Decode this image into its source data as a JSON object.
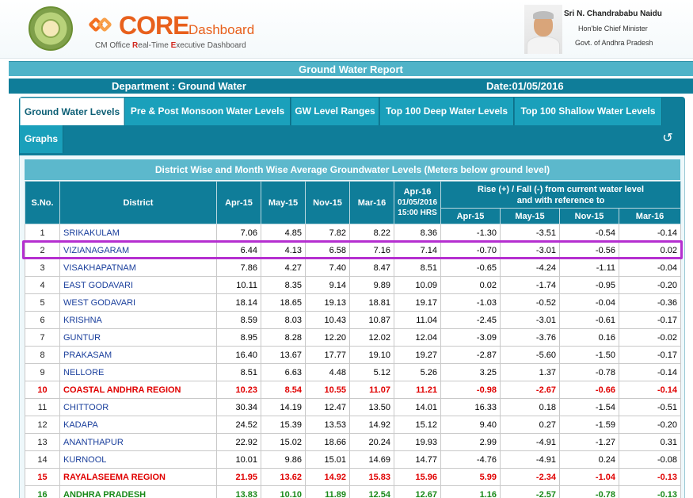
{
  "header": {
    "logo_word": "CORE",
    "logo_sub": "Dashboard",
    "tagline_parts": [
      "CM Office ",
      "R",
      "eal-Time ",
      "E",
      "xecutive Dashboard"
    ],
    "cm_name": "Sri N. Chandrababu Naidu",
    "cm_title": "Hon'ble Chief Minister",
    "cm_govt": "Govt. of Andhra Pradesh"
  },
  "report": {
    "title": "Ground Water Report",
    "department": "Department : Ground Water",
    "date": "Date:01/05/2016"
  },
  "tabs": [
    {
      "label": "Ground Water Levels",
      "active": true
    },
    {
      "label": "Pre & Post Monsoon Water Levels",
      "active": false
    },
    {
      "label": "GW Level Ranges",
      "active": false
    },
    {
      "label": "Top 100 Deep Water Levels",
      "active": false
    },
    {
      "label": "Top 100 Shallow Water Levels",
      "active": false
    },
    {
      "label": "Graphs",
      "active": false
    }
  ],
  "table": {
    "title": "District Wise and Month Wise Average Groundwater Levels (Meters below ground level)",
    "headers": {
      "sno": "S.No.",
      "district": "District",
      "apr15": "Apr-15",
      "may15": "May-15",
      "nov15": "Nov-15",
      "mar16": "Mar-16",
      "apr16_line1": "Apr-16",
      "apr16_line2": "01/05/2016",
      "apr16_line3": "15:00 HRS",
      "rise_line1": "Rise (+) / Fall (-) from current water level",
      "rise_line2": "and with reference to",
      "sub_apr15": "Apr-15",
      "sub_may15": "May-15",
      "sub_nov15": "Nov-15",
      "sub_mar16": "Mar-16"
    },
    "rows": [
      {
        "sno": "1",
        "district": "SRIKAKULAM",
        "apr15": "7.06",
        "may15": "4.85",
        "nov15": "7.82",
        "mar16": "8.22",
        "apr16": "8.36",
        "r_apr15": "-1.30",
        "r_may15": "-3.51",
        "r_nov15": "-0.54",
        "r_mar16": "-0.14",
        "type": "district"
      },
      {
        "sno": "2",
        "district": "VIZIANAGARAM",
        "apr15": "6.44",
        "may15": "4.13",
        "nov15": "6.58",
        "mar16": "7.16",
        "apr16": "7.14",
        "r_apr15": "-0.70",
        "r_may15": "-3.01",
        "r_nov15": "-0.56",
        "r_mar16": "0.02",
        "type": "district"
      },
      {
        "sno": "3",
        "district": "VISAKHAPATNAM",
        "apr15": "7.86",
        "may15": "4.27",
        "nov15": "7.40",
        "mar16": "8.47",
        "apr16": "8.51",
        "r_apr15": "-0.65",
        "r_may15": "-4.24",
        "r_nov15": "-1.11",
        "r_mar16": "-0.04",
        "type": "district"
      },
      {
        "sno": "4",
        "district": "EAST GODAVARI",
        "apr15": "10.11",
        "may15": "8.35",
        "nov15": "9.14",
        "mar16": "9.89",
        "apr16": "10.09",
        "r_apr15": "0.02",
        "r_may15": "-1.74",
        "r_nov15": "-0.95",
        "r_mar16": "-0.20",
        "type": "district"
      },
      {
        "sno": "5",
        "district": "WEST GODAVARI",
        "apr15": "18.14",
        "may15": "18.65",
        "nov15": "19.13",
        "mar16": "18.81",
        "apr16": "19.17",
        "r_apr15": "-1.03",
        "r_may15": "-0.52",
        "r_nov15": "-0.04",
        "r_mar16": "-0.36",
        "type": "district"
      },
      {
        "sno": "6",
        "district": "KRISHNA",
        "apr15": "8.59",
        "may15": "8.03",
        "nov15": "10.43",
        "mar16": "10.87",
        "apr16": "11.04",
        "r_apr15": "-2.45",
        "r_may15": "-3.01",
        "r_nov15": "-0.61",
        "r_mar16": "-0.17",
        "type": "district"
      },
      {
        "sno": "7",
        "district": "GUNTUR",
        "apr15": "8.95",
        "may15": "8.28",
        "nov15": "12.20",
        "mar16": "12.02",
        "apr16": "12.04",
        "r_apr15": "-3.09",
        "r_may15": "-3.76",
        "r_nov15": "0.16",
        "r_mar16": "-0.02",
        "type": "district"
      },
      {
        "sno": "8",
        "district": "PRAKASAM",
        "apr15": "16.40",
        "may15": "13.67",
        "nov15": "17.77",
        "mar16": "19.10",
        "apr16": "19.27",
        "r_apr15": "-2.87",
        "r_may15": "-5.60",
        "r_nov15": "-1.50",
        "r_mar16": "-0.17",
        "type": "district"
      },
      {
        "sno": "9",
        "district": "NELLORE",
        "apr15": "8.51",
        "may15": "6.63",
        "nov15": "4.48",
        "mar16": "5.12",
        "apr16": "5.26",
        "r_apr15": "3.25",
        "r_may15": "1.37",
        "r_nov15": "-0.78",
        "r_mar16": "-0.14",
        "type": "district"
      },
      {
        "sno": "10",
        "district": "COASTAL ANDHRA REGION",
        "apr15": "10.23",
        "may15": "8.54",
        "nov15": "10.55",
        "mar16": "11.07",
        "apr16": "11.21",
        "r_apr15": "-0.98",
        "r_may15": "-2.67",
        "r_nov15": "-0.66",
        "r_mar16": "-0.14",
        "type": "region"
      },
      {
        "sno": "11",
        "district": "CHITTOOR",
        "apr15": "30.34",
        "may15": "14.19",
        "nov15": "12.47",
        "mar16": "13.50",
        "apr16": "14.01",
        "r_apr15": "16.33",
        "r_may15": "0.18",
        "r_nov15": "-1.54",
        "r_mar16": "-0.51",
        "type": "district"
      },
      {
        "sno": "12",
        "district": "KADAPA",
        "apr15": "24.52",
        "may15": "15.39",
        "nov15": "13.53",
        "mar16": "14.92",
        "apr16": "15.12",
        "r_apr15": "9.40",
        "r_may15": "0.27",
        "r_nov15": "-1.59",
        "r_mar16": "-0.20",
        "type": "district"
      },
      {
        "sno": "13",
        "district": "ANANTHAPUR",
        "apr15": "22.92",
        "may15": "15.02",
        "nov15": "18.66",
        "mar16": "20.24",
        "apr16": "19.93",
        "r_apr15": "2.99",
        "r_may15": "-4.91",
        "r_nov15": "-1.27",
        "r_mar16": "0.31",
        "type": "district"
      },
      {
        "sno": "14",
        "district": "KURNOOL",
        "apr15": "10.01",
        "may15": "9.86",
        "nov15": "15.01",
        "mar16": "14.69",
        "apr16": "14.77",
        "r_apr15": "-4.76",
        "r_may15": "-4.91",
        "r_nov15": "0.24",
        "r_mar16": "-0.08",
        "type": "district"
      },
      {
        "sno": "15",
        "district": "RAYALASEEMA REGION",
        "apr15": "21.95",
        "may15": "13.62",
        "nov15": "14.92",
        "mar16": "15.83",
        "apr16": "15.96",
        "r_apr15": "5.99",
        "r_may15": "-2.34",
        "r_nov15": "-1.04",
        "r_mar16": "-0.13",
        "type": "region"
      },
      {
        "sno": "16",
        "district": "ANDHRA PRADESH",
        "apr15": "13.83",
        "may15": "10.10",
        "nov15": "11.89",
        "mar16": "12.54",
        "apr16": "12.67",
        "r_apr15": "1.16",
        "r_may15": "-2.57",
        "r_nov15": "-0.78",
        "r_mar16": "-0.13",
        "type": "state"
      }
    ]
  }
}
